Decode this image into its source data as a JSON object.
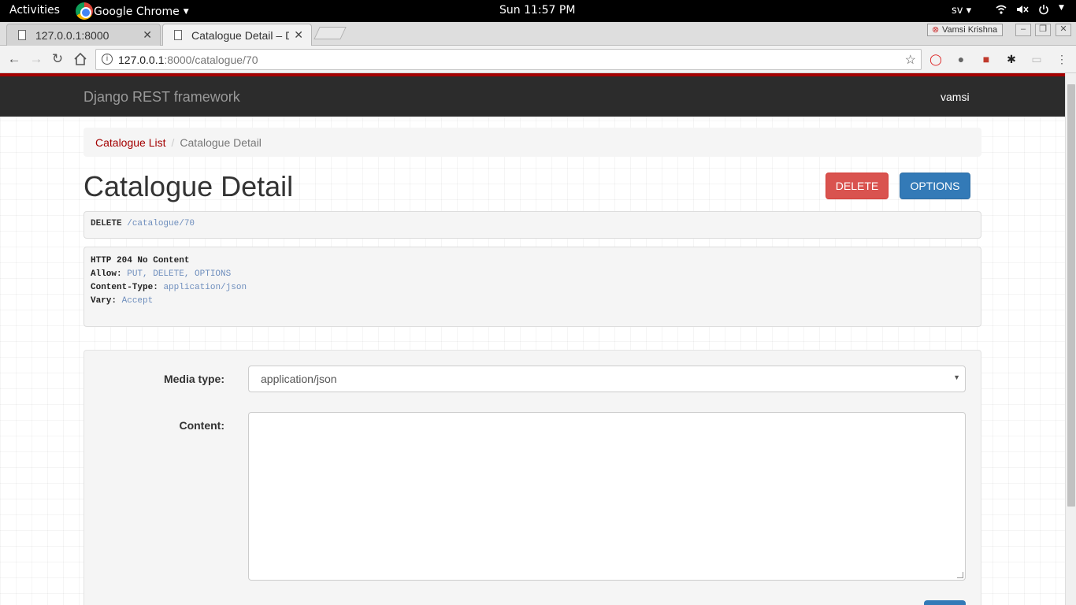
{
  "system_bar": {
    "activities": "Activities",
    "app_name": "Google Chrome",
    "clock": "Sun 11:57 PM",
    "language": "sv"
  },
  "browser": {
    "tabs": [
      {
        "title": "127.0.0.1:8000"
      },
      {
        "title": "Catalogue Detail – Dj"
      }
    ],
    "profile_user": "Vamsi Krishna",
    "url_host": "127.0.0.1",
    "url_path": ":8000/catalogue/70"
  },
  "navbar": {
    "brand": "Django REST framework",
    "user": "vamsi"
  },
  "breadcrumb": {
    "items": [
      {
        "label": "Catalogue List"
      },
      {
        "label": "Catalogue Detail"
      }
    ],
    "separator": "/"
  },
  "main": {
    "title": "Catalogue Detail",
    "delete_label": "DELETE",
    "options_label": "OPTIONS"
  },
  "request": {
    "method": "DELETE",
    "path": "/catalogue/70"
  },
  "response": {
    "status_line": "HTTP 204 No Content",
    "headers": [
      {
        "name": "Allow:",
        "value": "PUT, DELETE, OPTIONS"
      },
      {
        "name": "Content-Type:",
        "value": "application/json"
      },
      {
        "name": "Vary:",
        "value": "Accept"
      }
    ]
  },
  "form": {
    "media_type_label": "Media type:",
    "media_type_value": "application/json",
    "content_label": "Content:",
    "content_value": ""
  },
  "colors": {
    "accent_red": "#a30000",
    "delete_button": "#d9534f",
    "options_button": "#337ab7",
    "navbar_bg": "#2c2c2c"
  }
}
